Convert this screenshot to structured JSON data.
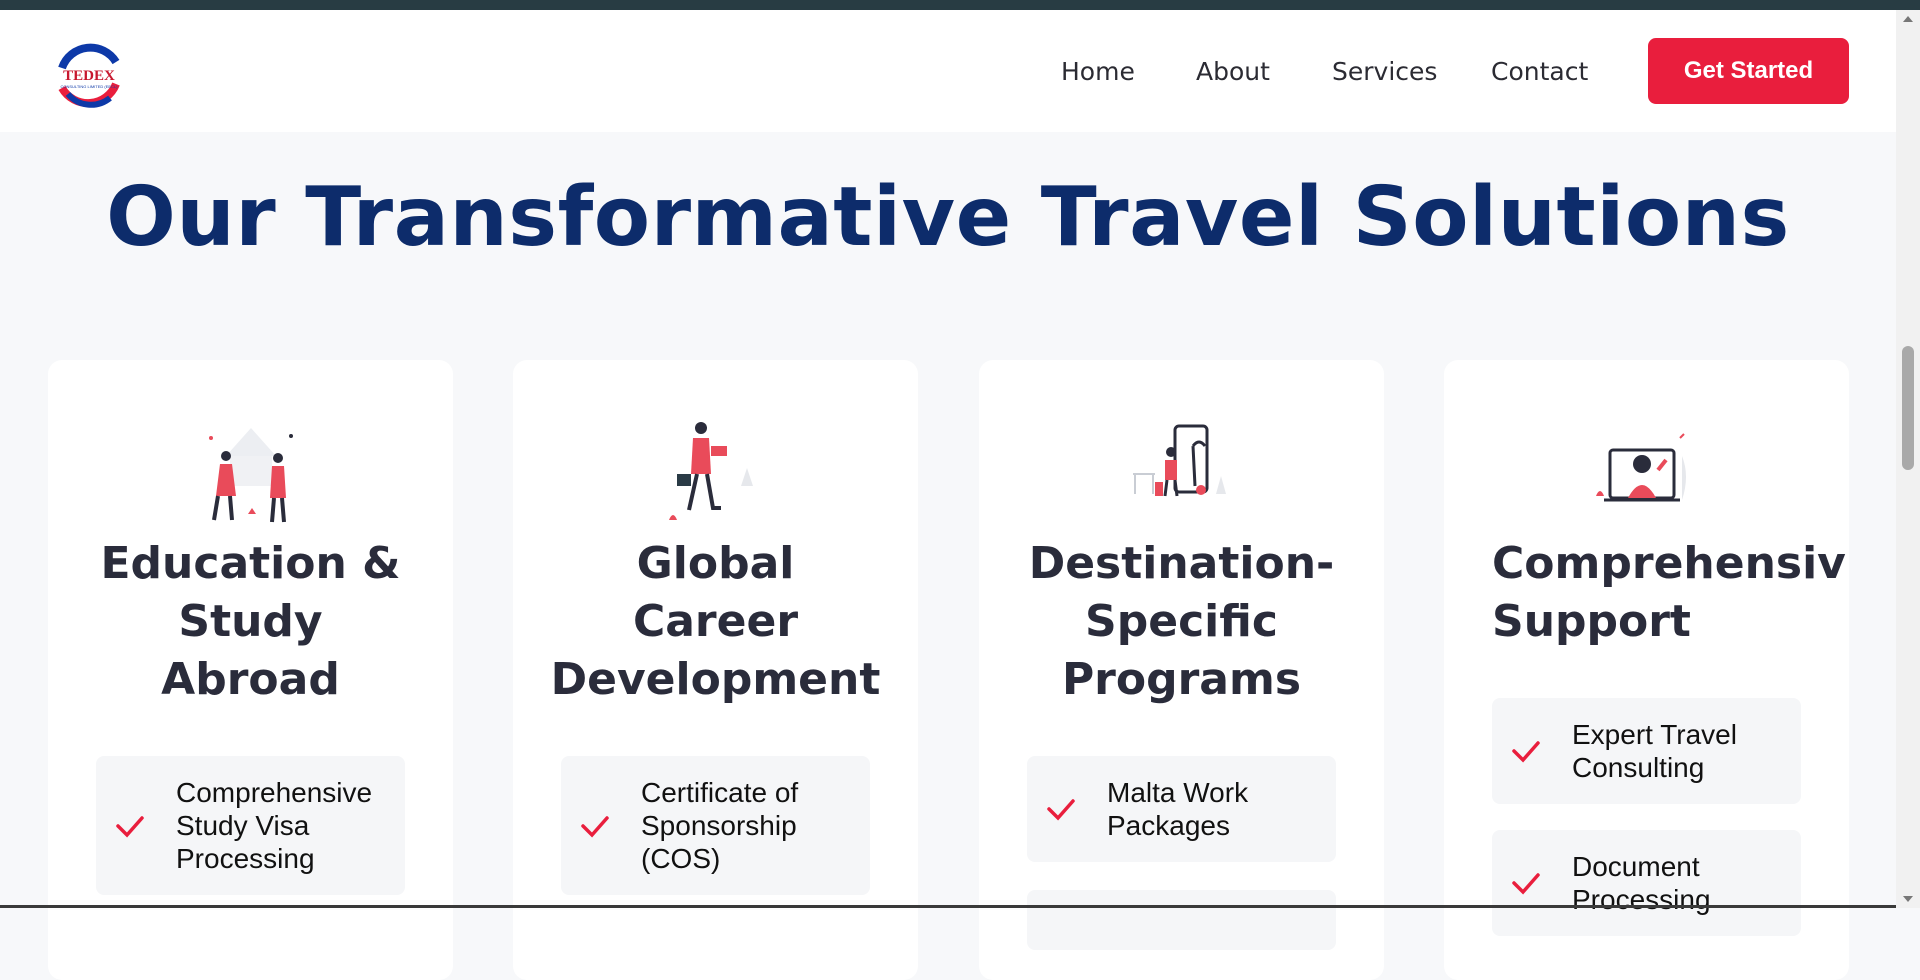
{
  "brand": {
    "logo_text": "TEDEX",
    "logo_subtext": "CONSULTING LIMITED (EECL)",
    "colors": {
      "primary_blue": "#0d2c6b",
      "accent_red": "#e91e3d"
    }
  },
  "nav": {
    "links": [
      "Home",
      "About",
      "Services",
      "Contact"
    ],
    "cta_label": "Get Started"
  },
  "section": {
    "title": "Our Transformative Travel Solutions"
  },
  "cards": [
    {
      "title": "Education &\nStudy\nAbroad",
      "illustration": "graduates-illustration",
      "features": [
        "Comprehensive Study Visa Processing"
      ]
    },
    {
      "title": "Global\nCareer\nDevelopment",
      "illustration": "career-woman-illustration",
      "features": [
        "Certificate of Sponsorship (COS)"
      ]
    },
    {
      "title": "Destination-\nSpecific\nPrograms",
      "illustration": "traveler-phone-illustration",
      "features": [
        "Malta Work Packages"
      ]
    },
    {
      "title": "Comprehensiv\nSupport",
      "illustration": "video-support-illustration",
      "features": [
        "Expert Travel Consulting",
        "Document Processing"
      ]
    }
  ],
  "icons": {
    "feature_check": "check-icon"
  }
}
